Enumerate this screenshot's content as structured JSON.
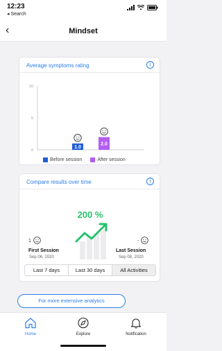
{
  "status_bar": {
    "time": "12:23",
    "back_app": "◂ Search"
  },
  "nav": {
    "title": "Mindset",
    "back_glyph": "‹"
  },
  "symptoms_card": {
    "title": "Average symptoms rating",
    "info_icon": "info-icon",
    "chart_data": {
      "type": "bar",
      "categories": [
        "Before session",
        "After session"
      ],
      "values": [
        1.0,
        2.0
      ],
      "value_labels": [
        "1.0",
        "2.0"
      ],
      "ylim": [
        0,
        10
      ],
      "yticks": [
        0,
        5,
        10
      ],
      "colors": [
        "#1f5fd6",
        "#b45df2"
      ],
      "legend": [
        "Before session",
        "After session"
      ],
      "legend_position": "bottom",
      "grid": false
    }
  },
  "compare_card": {
    "title": "Compare results over time",
    "info_icon": "info-icon",
    "change_percent": "200 %",
    "first": {
      "label": "First Session",
      "date": "Sep 06, 2020",
      "score": "1"
    },
    "last": {
      "label": "Last Session",
      "date": "Sep 08, 2020",
      "score": "-"
    },
    "trend_color": "#27c26d",
    "tabs": [
      {
        "label": "Last 7 days",
        "active": false
      },
      {
        "label": "Last 30 days",
        "active": false
      },
      {
        "label": "All Activities",
        "active": true
      }
    ]
  },
  "analytics_button": {
    "label": "For more extensive analytics"
  },
  "tab_bar": {
    "items": [
      {
        "label": "Home",
        "icon": "home-icon",
        "active": true
      },
      {
        "label": "Explore",
        "icon": "compass-icon",
        "active": false
      },
      {
        "label": "Notification",
        "icon": "bell-icon",
        "active": false
      }
    ]
  },
  "colors": {
    "accent": "#2b7de9",
    "positive": "#27c26d",
    "background": "#f2f2f4"
  }
}
